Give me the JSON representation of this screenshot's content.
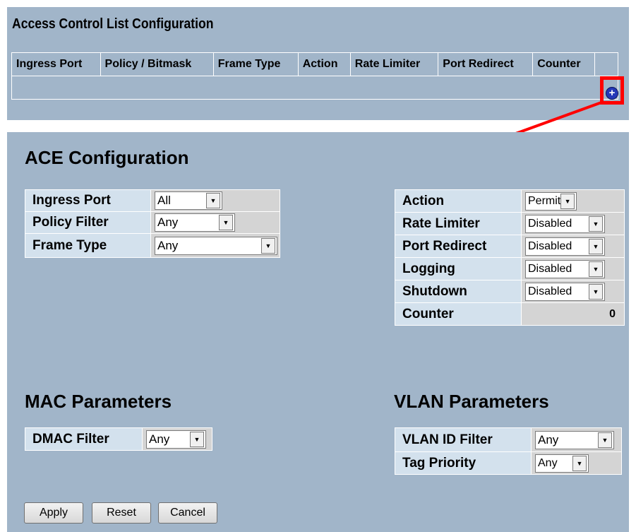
{
  "acl": {
    "title": "Access Control List Configuration",
    "columns": [
      "Ingress Port",
      "Policy / Bitmask",
      "Frame Type",
      "Action",
      "Rate Limiter",
      "Port Redirect",
      "Counter"
    ],
    "add_icon": "plus-circle-icon"
  },
  "annotation": {
    "color": "#ff0000"
  },
  "ace": {
    "title": "ACE Configuration",
    "left": {
      "ingress_port": {
        "label": "Ingress Port",
        "value": "All"
      },
      "policy_filter": {
        "label": "Policy Filter",
        "value": "Any"
      },
      "frame_type": {
        "label": "Frame Type",
        "value": "Any"
      }
    },
    "right": {
      "action": {
        "label": "Action",
        "value": "Permit"
      },
      "rate_limiter": {
        "label": "Rate Limiter",
        "value": "Disabled"
      },
      "port_redirect": {
        "label": "Port Redirect",
        "value": "Disabled"
      },
      "logging": {
        "label": "Logging",
        "value": "Disabled"
      },
      "shutdown": {
        "label": "Shutdown",
        "value": "Disabled"
      },
      "counter": {
        "label": "Counter",
        "value": "0"
      }
    }
  },
  "mac": {
    "title": "MAC Parameters",
    "dmac_filter": {
      "label": "DMAC Filter",
      "value": "Any"
    }
  },
  "vlan": {
    "title": "VLAN Parameters",
    "vlan_id_filter": {
      "label": "VLAN ID Filter",
      "value": "Any"
    },
    "tag_priority": {
      "label": "Tag Priority",
      "value": "Any"
    }
  },
  "buttons": {
    "apply": "Apply",
    "reset": "Reset",
    "cancel": "Cancel"
  },
  "colors": {
    "panel_bg": "#a1b5c9",
    "label_bg": "#d3e1ed",
    "value_bg": "#d4d4d4"
  }
}
